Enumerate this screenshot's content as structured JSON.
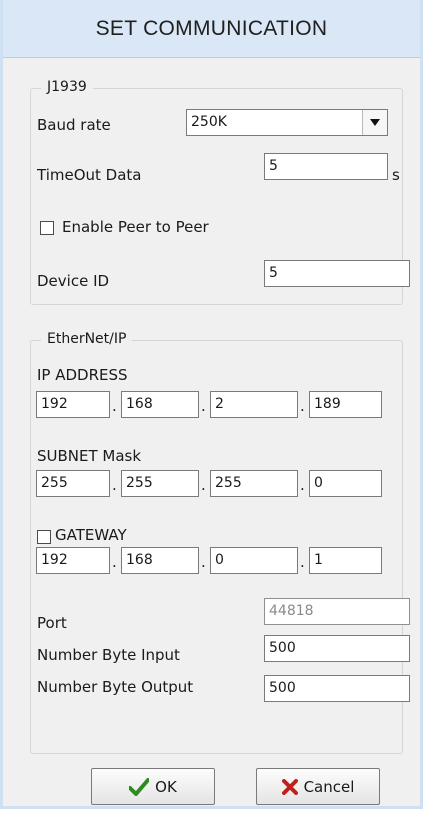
{
  "title": "SET COMMUNICATION",
  "j1939": {
    "legend": "J1939",
    "baud_rate_label": "Baud rate",
    "baud_rate_value": "250K",
    "timeout_label": "TimeOut Data",
    "timeout_value": "5",
    "timeout_unit": "s",
    "peer_label": "Enable Peer to Peer",
    "peer_checked": false,
    "device_id_label": "Device ID",
    "device_id_value": "5"
  },
  "ethernet": {
    "legend": "EtherNet/IP",
    "ip_label": "IP ADDRESS",
    "ip": [
      "192",
      "168",
      "2",
      "189"
    ],
    "subnet_label": "SUBNET Mask",
    "subnet": [
      "255",
      "255",
      "255",
      "0"
    ],
    "gateway_label": "GATEWAY",
    "gateway_checked": false,
    "gateway": [
      "192",
      "168",
      "0",
      "1"
    ],
    "port_label": "Port",
    "port_value": "44818",
    "input_label": "Number Byte Input",
    "input_value": "500",
    "output_label": "Number Byte Output",
    "output_value": "500"
  },
  "buttons": {
    "ok_label": "OK",
    "cancel_label": "Cancel"
  },
  "icons": {
    "ok": "checkmark-icon",
    "cancel": "x-mark-icon",
    "dropdown": "dropdown-arrow-icon"
  },
  "colors": {
    "titlebar": "#d9e7f6",
    "ok_check": "#2e8b1f",
    "cancel_x": "#c0201a"
  }
}
